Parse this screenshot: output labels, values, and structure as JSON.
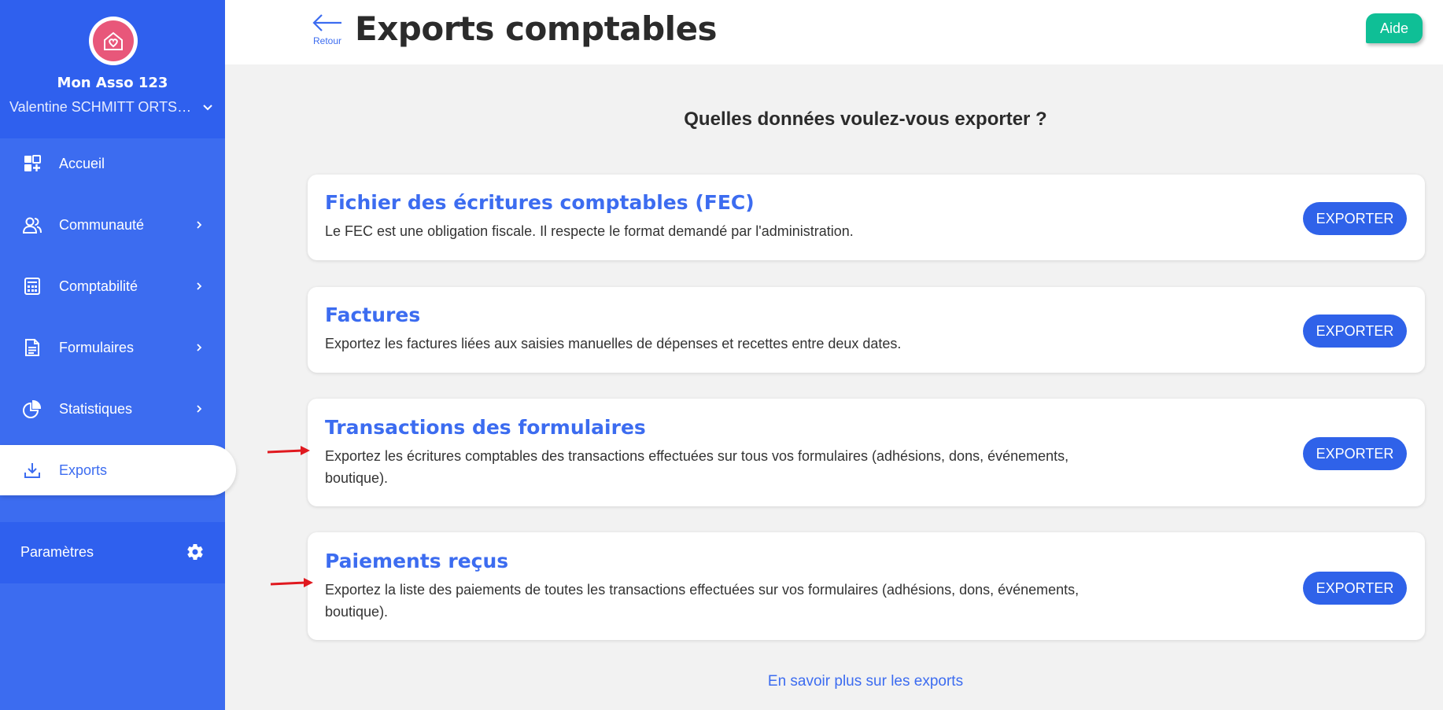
{
  "sidebar": {
    "org_name": "Mon Asso 123",
    "user_name": "Valentine SCHMITT ORTSCHEIDT",
    "items": [
      {
        "label": "Accueil",
        "icon": "dashboard-icon",
        "has_chevron": false
      },
      {
        "label": "Communauté",
        "icon": "users-icon",
        "has_chevron": true
      },
      {
        "label": "Comptabilité",
        "icon": "calculator-icon",
        "has_chevron": true
      },
      {
        "label": "Formulaires",
        "icon": "document-icon",
        "has_chevron": true
      },
      {
        "label": "Statistiques",
        "icon": "pie-chart-icon",
        "has_chevron": true
      },
      {
        "label": "Exports",
        "icon": "download-icon",
        "active": true
      }
    ],
    "settings_label": "Paramètres"
  },
  "header": {
    "back_label": "Retour",
    "title": "Exports comptables",
    "help_label": "Aide"
  },
  "main": {
    "question": "Quelles données voulez-vous exporter ?",
    "cards": [
      {
        "title": "Fichier des écritures comptables (FEC)",
        "description": "Le FEC est une obligation fiscale. Il respecte le format demandé par l'administration.",
        "button": "EXPORTER"
      },
      {
        "title": "Factures",
        "description": "Exportez les factures liées aux saisies manuelles de dépenses et recettes entre deux dates.",
        "button": "EXPORTER"
      },
      {
        "title": "Transactions des formulaires",
        "description": "Exportez les écritures comptables des transactions effectuées sur tous vos formulaires (adhésions, dons, événements, boutique).",
        "button": "EXPORTER"
      },
      {
        "title": "Paiements reçus",
        "description": "Exportez la liste des paiements de toutes les transactions effectuées sur vos formulaires (adhésions, dons, événements, boutique).",
        "button": "EXPORTER"
      }
    ],
    "more_link": "En savoir plus sur les exports"
  },
  "colors": {
    "brand_blue": "#3c6cf0",
    "sidebar_dark": "#2f60ee",
    "help_green": "#0fbf96",
    "logo_pink": "#e8577a",
    "annotation_red": "#e0191f"
  }
}
